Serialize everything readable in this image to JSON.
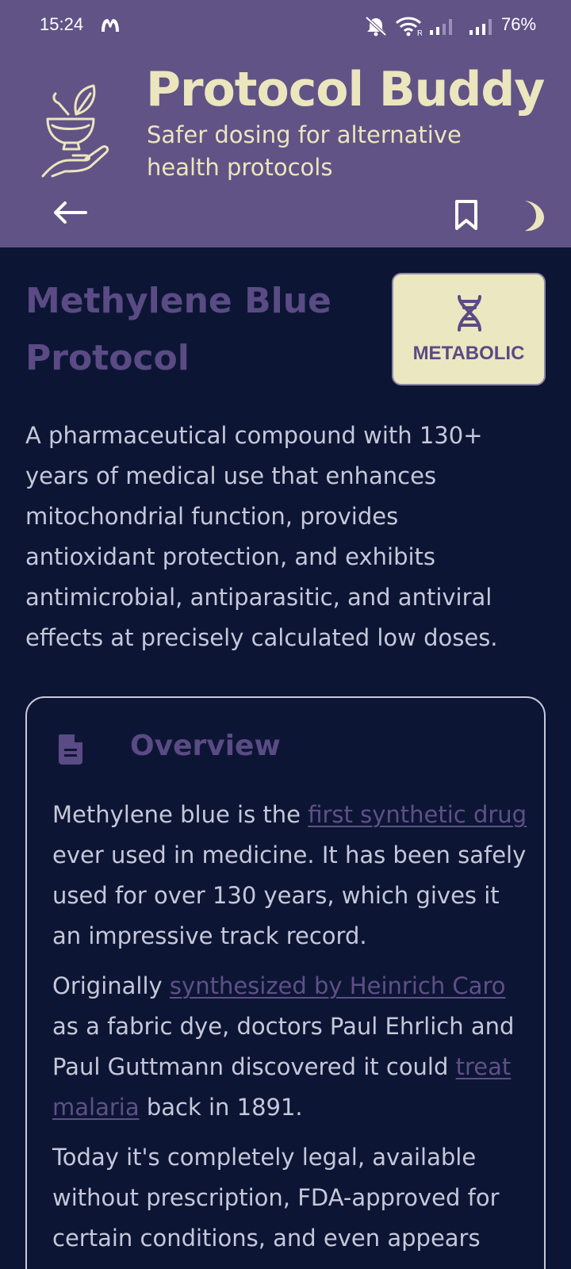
{
  "status_bar": {
    "time": "15:24",
    "battery": "76%",
    "icons": [
      "app-notification-icon",
      "mute-icon",
      "wifi-icon",
      "signal-icon",
      "signal-icon",
      "battery"
    ]
  },
  "header": {
    "logo_icon": "mortar-pestle-hand-icon",
    "title": "Protocol Buddy",
    "subtitle": "Safer dosing for alternative health protocols",
    "back_icon": "arrow-left-icon",
    "bookmark_icon": "bookmark-icon",
    "theme_icon": "moon-icon"
  },
  "protocol": {
    "title": "Methylene Blue Protocol",
    "category": "METABOLIC",
    "category_icon": "dna-icon",
    "intro": "A pharmaceutical compound with 130+ years of medical use that enhances mitochondrial function, provides antioxidant protection, and exhibits antimicrobial, antiparasitic, and antiviral effects at precisely calculated low doses."
  },
  "overview": {
    "heading": "Overview",
    "heading_icon": "document-icon",
    "p1_before": "Methylene blue is the ",
    "p1_link": "first synthetic drug",
    "p1_after": " ever used in medicine. It has been safely used for over 130 years, which gives it an impressive track record.",
    "p2_before": "Originally ",
    "p2_link1": "synthesized by Heinrich Caro",
    "p2_mid": " as a fabric dye, doctors Paul Ehrlich and Paul Guttmann discovered it could ",
    "p2_link2": "treat malaria",
    "p2_after": " back in 1891.",
    "p3": "Today it's completely legal, available without prescription, FDA-approved for certain conditions, and even appears"
  },
  "colors": {
    "header_bg": "#615386",
    "page_bg": "#0d1535",
    "accent_cream": "#ebe6be",
    "accent_purple": "#5a4b84"
  }
}
